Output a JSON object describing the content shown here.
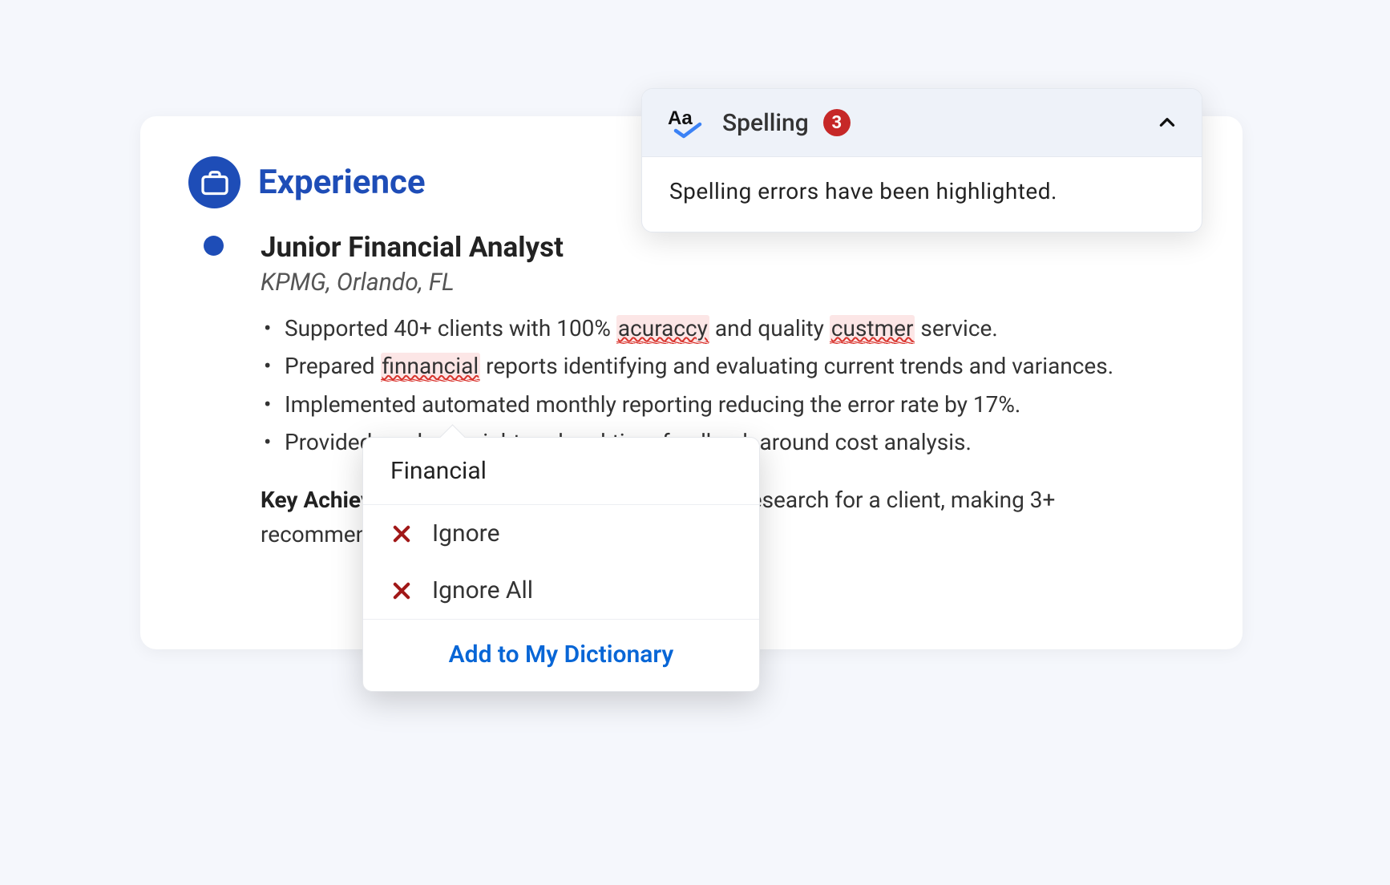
{
  "section": {
    "title": "Experience"
  },
  "entry": {
    "jobTitle": "Junior Financial Analyst",
    "company": "KPMG, Orlando, FL",
    "bullets": {
      "b0": {
        "pre": "Supported 40+ clients with 100% ",
        "err1": "acuraccy",
        "mid": " and quality ",
        "err2": "custmer",
        "post": " service."
      },
      "b1": {
        "pre": "Prepared ",
        "err": "finnancial",
        "post": " reports identifying and evaluating current trends and variances."
      },
      "b2": "Implemented automated monthly reporting reducing the error rate by 17%.",
      "b3": "Provided market insight and real-time feedback around cost analysis."
    },
    "keyAchLabel": "Key Achievements:",
    "keyAchText": " Conducted industry-specific research for a client, making 3+  recommendations, all of which were adopted."
  },
  "spellPanel": {
    "title": "Spelling",
    "count": "3",
    "body": "Spelling errors have been highlighted."
  },
  "contextMenu": {
    "suggestion": "Financial",
    "ignore": "Ignore",
    "ignoreAll": "Ignore All",
    "addDict": "Add to My Dictionary"
  }
}
